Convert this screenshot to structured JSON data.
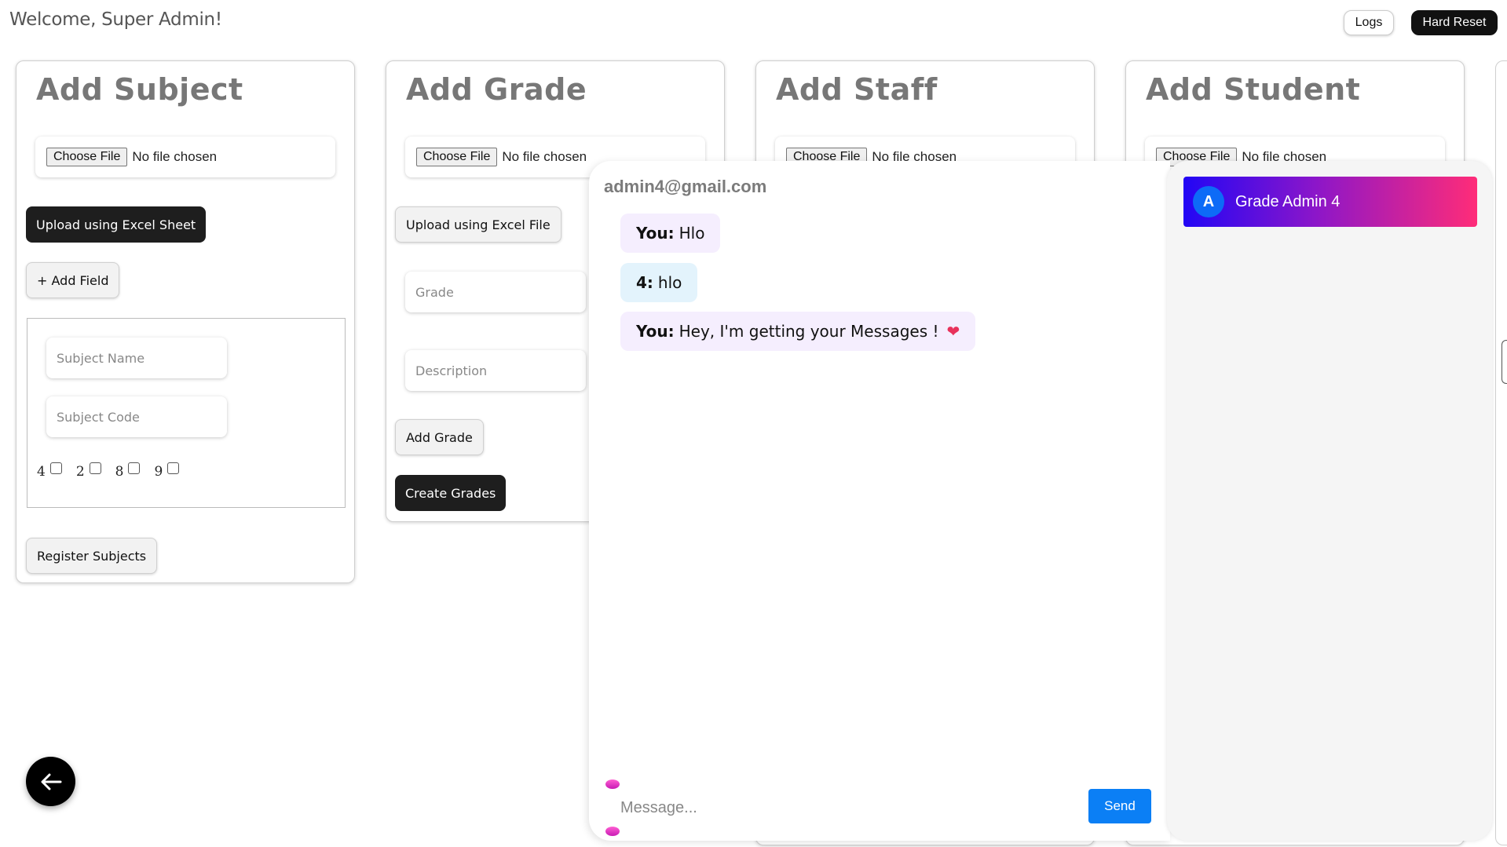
{
  "header": {
    "welcome": "Welcome, Super Admin!",
    "logs_label": "Logs",
    "reset_label": "Hard Reset"
  },
  "file_input": {
    "choose_label": "Choose File",
    "status": "No file chosen"
  },
  "subject_card": {
    "title": "Add Subject",
    "upload_label": "Upload using Excel Sheet",
    "add_field_label": "+ Add Field",
    "subject_name_placeholder": "Subject Name",
    "subject_code_placeholder": "Subject Code",
    "grades": [
      "4",
      "2",
      "8",
      "9"
    ],
    "register_label": "Register Subjects"
  },
  "grade_card": {
    "title": "Add Grade",
    "upload_label": "Upload using Excel File",
    "grade_placeholder": "Grade",
    "description_placeholder": "Description",
    "add_label": "Add Grade",
    "create_label": "Create Grades"
  },
  "staff_card": {
    "title": "Add Staff"
  },
  "student_card": {
    "title": "Add Student"
  },
  "chat": {
    "email": "admin4@gmail.com",
    "messages": [
      {
        "sender": "You:",
        "text": "Hlo",
        "kind": "you"
      },
      {
        "sender": "4:",
        "text": "hlo",
        "kind": "them"
      },
      {
        "sender": "You:",
        "text": "Hey, I'm getting your Messages !",
        "kind": "you",
        "emoji": "❤"
      }
    ],
    "input_placeholder": "Message...",
    "send_label": "Send"
  },
  "contacts": [
    {
      "initial": "A",
      "name": "Grade Admin 4"
    }
  ],
  "colors": {
    "send": "#0b7ff5",
    "contact_gradient_start": "#2206f5",
    "contact_gradient_end": "#ff2c78",
    "avatar": "#0d6bf7"
  },
  "icons": {
    "back": "arrow-left-icon"
  }
}
